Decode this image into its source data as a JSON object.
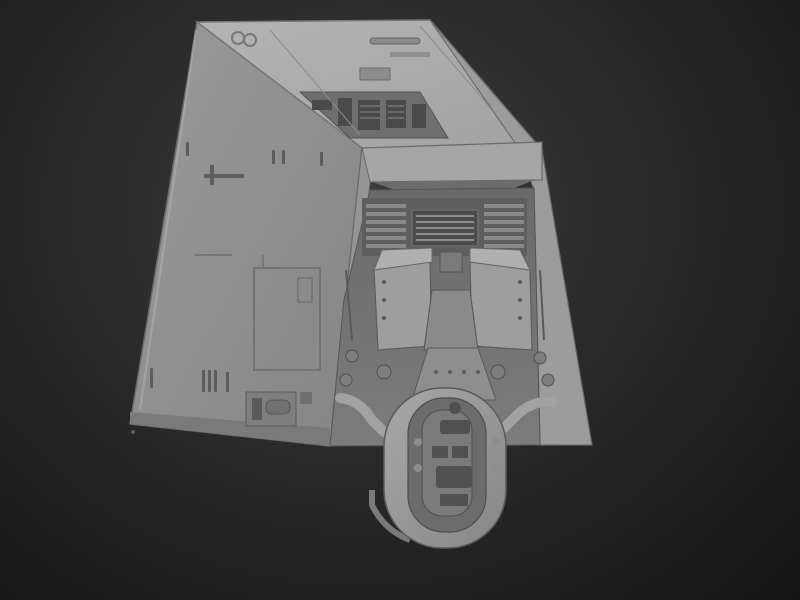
{
  "scene": {
    "subject": "",
    "colors": {
      "background_center": "#3c3c3c",
      "background_edge": "#141414",
      "hull_light": "#a9a9a9",
      "hull_mid": "#8c8c8c",
      "hull_dark": "#5e5e5e",
      "detail_dark": "#3f3f3f"
    }
  }
}
